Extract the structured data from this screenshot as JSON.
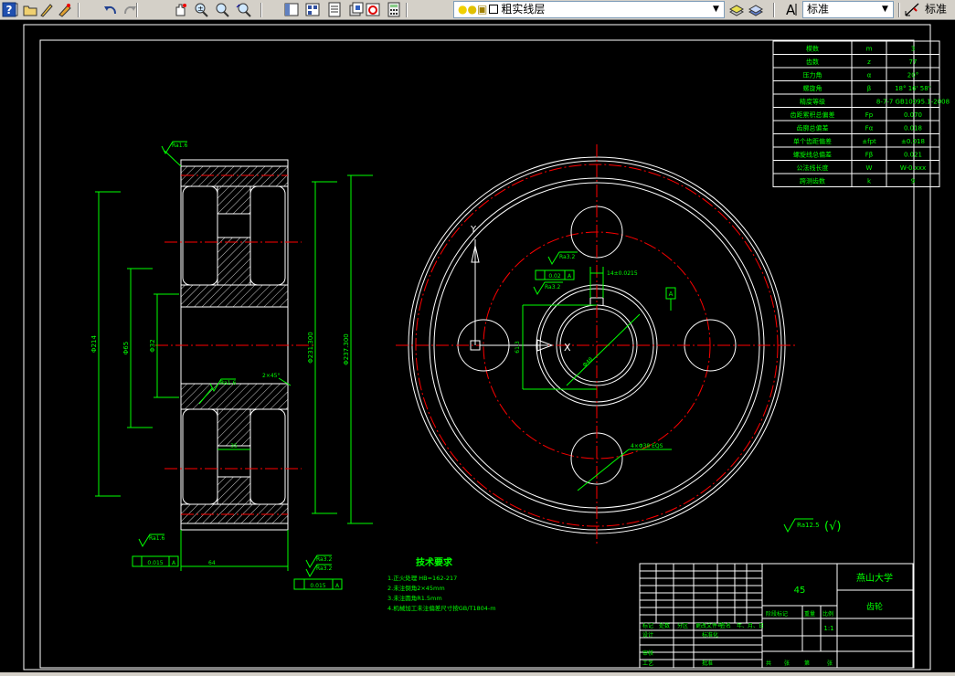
{
  "toolbar": {
    "buttons_left": [
      {
        "name": "new-file-icon"
      },
      {
        "name": "open-file-icon"
      },
      {
        "name": "pencil-icon"
      },
      {
        "name": "match-properties-icon"
      },
      {
        "name": "undo-icon"
      },
      {
        "name": "redo-icon"
      },
      {
        "name": "pan-icon"
      },
      {
        "name": "zoom-realtime-icon"
      },
      {
        "name": "zoom-window-icon"
      },
      {
        "name": "zoom-previous-icon"
      },
      {
        "name": "properties-icon"
      },
      {
        "name": "design-center-icon"
      },
      {
        "name": "tool-palettes-icon"
      },
      {
        "name": "sheet-set-icon"
      },
      {
        "name": "markup-icon"
      },
      {
        "name": "calculator-icon"
      },
      {
        "name": "help-icon"
      }
    ],
    "layer_combo": {
      "value": "粗实线层",
      "state_icons": [
        "bulb-icon",
        "sun-icon",
        "lock-icon",
        "color-box-icon"
      ]
    },
    "layer_buttons": [
      {
        "name": "make-current-layer-icon"
      },
      {
        "name": "layer-previous-icon"
      }
    ],
    "text_style": {
      "icon": "text-style-icon",
      "value": "标准"
    },
    "dim_style": {
      "icon": "dim-style-icon",
      "value": "标准"
    }
  },
  "drawing": {
    "colors": {
      "outline": "#ffffff",
      "dimension": "#00ff00",
      "center": "#ff0000",
      "hatch": "#ffffff",
      "paper": "#000000"
    },
    "parameter_table": {
      "rows": [
        [
          "模数",
          "m",
          "3"
        ],
        [
          "齿数",
          "z",
          "77"
        ],
        [
          "压力角",
          "α",
          "20°"
        ],
        [
          "螺旋角",
          "β",
          "18° 16' 58\""
        ],
        [
          "精度等级",
          "",
          "8-7-7 GB10095.1-2008"
        ],
        [
          "齿距累积总偏差",
          "Fp",
          "0.070"
        ],
        [
          "齿廓总偏差",
          "Fα",
          "0.018"
        ],
        [
          "单个齿距偏差",
          "±fpt",
          "±0.018"
        ],
        [
          "螺旋线总偏差",
          "Fβ",
          "0.021"
        ],
        [
          "公法线长度",
          "W",
          "W-0.xxx"
        ],
        [
          "跨测齿数",
          "k",
          "9"
        ]
      ]
    },
    "section_view": {
      "diameters": [
        "Φ214",
        "Φ65",
        "Φ32",
        "Φ231.300",
        "Φ237.300"
      ],
      "roughness": [
        "Ra1.6",
        "Ra1.6",
        "Ra1.6",
        "Ra3.2",
        "Ra3.2"
      ],
      "chamfer": "2×45°",
      "web_width": "35",
      "face_width": "64",
      "tolerance_boxes": [
        "0.015",
        "A",
        "0.015",
        "A"
      ]
    },
    "front_view": {
      "labels": [
        "Y",
        "X",
        "A",
        "Ra3.2",
        "Ra3.2",
        "0.02",
        "A",
        "14±0.0215",
        "61.3",
        "Φ48",
        "4×Φ38 EQS"
      ]
    },
    "general_roughness": {
      "value": "Ra12.5",
      "suffix": "(√)"
    },
    "tech_requirements": {
      "title": "技术要求",
      "items": [
        "1.正火处理 HB=162-217",
        "2.未注倒角2×45mm",
        "3.未注圆角R1.5mm",
        "4.机械加工未注偏差尺寸按GB/T1804-m"
      ]
    },
    "title_block": {
      "material": "45",
      "university": "燕山大学",
      "part_name": "齿轮",
      "scale": "1:1",
      "cells": {
        "mark": "标记",
        "count": "处数",
        "zone": "分区",
        "change_doc": "更改文件号",
        "sign": "签名",
        "date": "年、月、日",
        "designer": "设计",
        "standardize": "标准化",
        "stage_mark": "阶段标记",
        "weight": "重量",
        "ratio": "比例",
        "review": "审核",
        "process": "工艺",
        "approve": "批准",
        "total": "共",
        "sheets": "张",
        "page": "第",
        "page_sheet": "张"
      }
    }
  }
}
